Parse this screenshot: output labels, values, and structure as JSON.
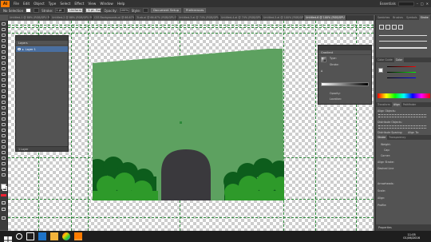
{
  "app": {
    "logo": "Ai",
    "menu": [
      "File",
      "Edit",
      "Object",
      "Type",
      "Select",
      "Effect",
      "View",
      "Window",
      "Help"
    ],
    "workspace": "Essentials"
  },
  "control_bar": {
    "selection": "No Selection",
    "stroke_label": "Stroke:",
    "stroke_value": "1 pt",
    "style_label": "Uniform",
    "brush_label": "5 pt. Round",
    "opacity_label": "Opacity:",
    "opacity_value": "100%",
    "style2_label": "Style:",
    "doc_setup_button": "Document Setup",
    "prefs_button": "Preferences"
  },
  "tabs": [
    "Untitled-1 @ 88% (RGB/GPU Preview)",
    "Untitled-2 @ 88% (RGB/GPU Preview)",
    "CSS Backgrounds.ai @ 66.67% (RGB/GPU)",
    "3Lab.ai @ 66.67% (RGB/GPU Preview)",
    "Untitled-3.ai @ 74% (RGB/GPU Preview)",
    "Untitled-4.ai @ 74% (RGB/GPU Preview)",
    "Untitled-5.ai @ 100% (RGB/GPU Preview)",
    "Untitled-6 @ 100% (RGB/GPU Preview)"
  ],
  "active_tab": 7,
  "layers_panel": {
    "tab": "Layers",
    "layer_name": "Layer 1",
    "footer": "1 Layer"
  },
  "gradient_panel": {
    "title": "Gradient",
    "type_label": "Type:",
    "stroke_label": "Stroke:",
    "angle_label": "∆",
    "opacity_label": "Opacity:",
    "location_label": "Location:"
  },
  "right_dock": {
    "top_tabs": [
      "Swatches",
      "Brushes",
      "Symbols",
      "Stroke"
    ],
    "color_tabs": [
      "Color Guide",
      "Color"
    ],
    "transform_tabs": [
      "Transform",
      "Align",
      "Pathfinder"
    ],
    "align_objects": "Align Objects:",
    "distribute_objects": "Distribute Objects:",
    "distribute_spacing": "Distribute Spacing:",
    "align_to": "Align To:",
    "stroke_tabs": [
      "Stroke",
      "Transparency"
    ],
    "weight_label": "Weight:",
    "cap_label": "Cap:",
    "corner_label": "Corner:",
    "align_stroke_label": "Align Stroke:",
    "dashed_line": "Dashed Line",
    "arrowheads_label": "Arrowheads:",
    "scale_label": "Scale:",
    "align_label": "Align:",
    "profile_label": "Profile:",
    "properties_label": "Properties"
  },
  "colors": {
    "sky": "#5da160",
    "tunnel": "#3a393d",
    "bush_dark": "#0d5d1c",
    "bush_light": "#2e9a2a",
    "guide": "#2d8a3a"
  },
  "taskbar": {
    "time": "11:05",
    "date": "01/06/2016"
  }
}
